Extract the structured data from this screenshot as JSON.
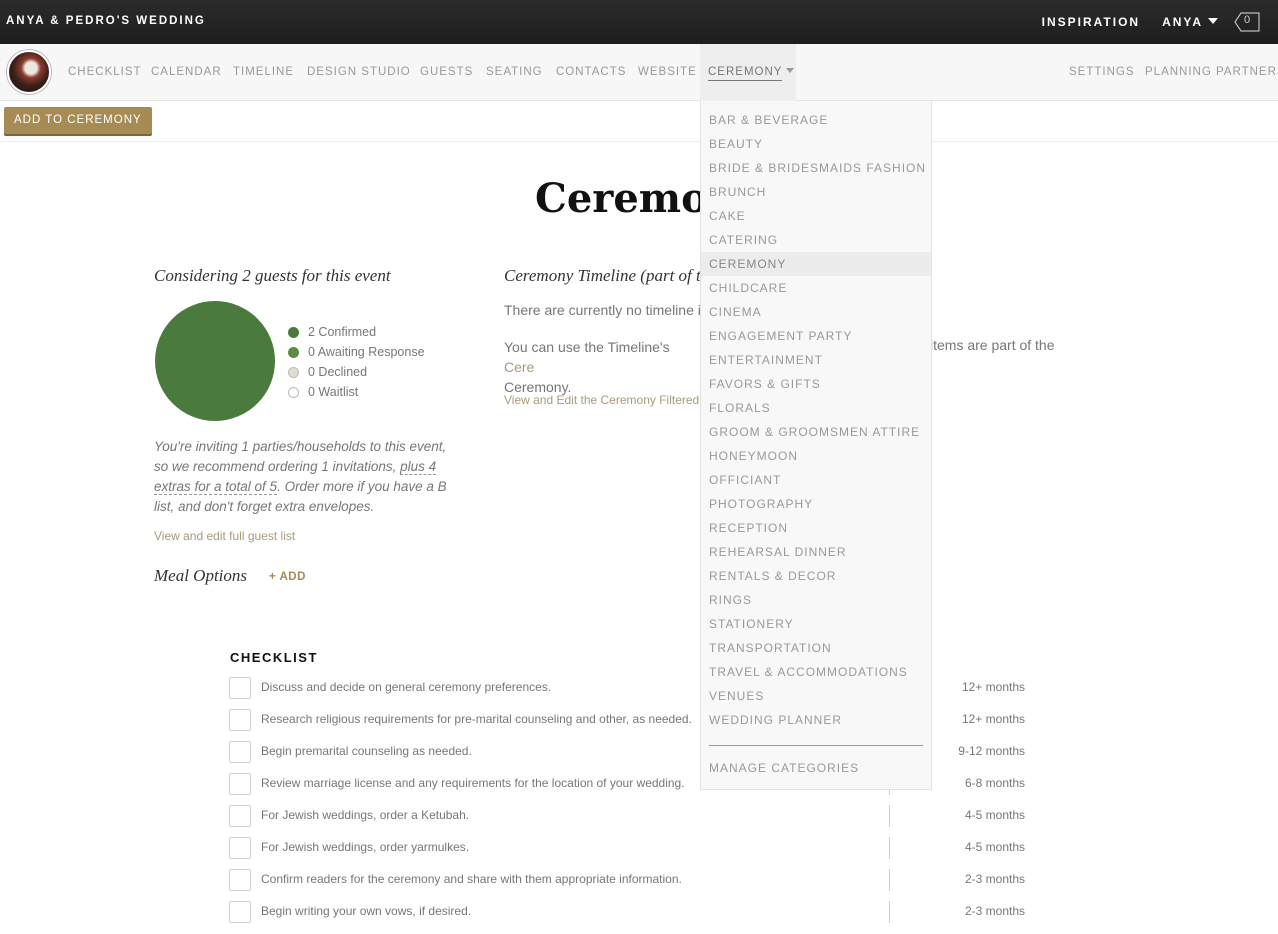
{
  "topbar": {
    "brand": "ANYA & PEDRO'S WEDDING",
    "inspiration": "INSPIRATION",
    "user": "ANYA",
    "cart_count": "0"
  },
  "nav": {
    "items": [
      "CHECKLIST",
      "CALENDAR",
      "TIMELINE",
      "DESIGN STUDIO",
      "GUESTS",
      "SEATING",
      "CONTACTS",
      "WEBSITE"
    ],
    "active": "CEREMONY",
    "right": [
      "SETTINGS",
      "PLANNING PARTNERS"
    ]
  },
  "actions": {
    "add_button": "ADD TO CEREMONY"
  },
  "page": {
    "title": "Ceremony"
  },
  "guests": {
    "heading": "Considering 2 guests for this event",
    "legend": [
      {
        "label": "2 Confirmed",
        "color": "#4a7a3d"
      },
      {
        "label": "0 Awaiting Response",
        "color": "#5c8a48"
      },
      {
        "label": "0 Declined",
        "color": "#e0ddd0"
      },
      {
        "label": "0 Waitlist",
        "color": "#ffffff"
      }
    ],
    "invite_text_1": "You're inviting 1 parties/households to this event, so we recommend ordering 1 invitations, ",
    "invite_text_u": "plus 4 extras for a total of 5",
    "invite_text_2": ". Order more if you have a B list, and don't forget extra envelopes.",
    "link": "View and edit full guest list"
  },
  "meal": {
    "heading": "Meal Options",
    "add": "+ ADD"
  },
  "timeline": {
    "heading": "Ceremony Timeline (part of the",
    "text1": "There are currently no timeline items",
    "text2_a": "You can use the Timeline's ",
    "text2_link": "Cere",
    "text2_b": "items are part of the",
    "text2_c": "Ceremony.",
    "link": "View and Edit the Ceremony Filtered Timeline"
  },
  "checklist": {
    "heading": "CHECKLIST",
    "items": [
      {
        "text": "Discuss and decide on general ceremony preferences.",
        "time": "12+ months"
      },
      {
        "text": "Research religious requirements for pre-marital counseling and other, as needed.",
        "time": "12+ months"
      },
      {
        "text": "Begin premarital counseling as needed.",
        "time": "9-12 months"
      },
      {
        "text": "Review marriage license and any requirements for the location of your wedding.",
        "time": "6-8 months"
      },
      {
        "text": "For Jewish weddings, order a Ketubah.",
        "time": "4-5 months"
      },
      {
        "text": "For Jewish weddings, order yarmulkes.",
        "time": "4-5 months"
      },
      {
        "text": "Confirm readers for the ceremony and share with them appropriate information.",
        "time": "2-3 months"
      },
      {
        "text": "Begin writing your own vows, if desired.",
        "time": "2-3 months"
      }
    ]
  },
  "dropdown": {
    "items": [
      "BAR & BEVERAGE",
      "BEAUTY",
      "BRIDE & BRIDESMAIDS FASHION",
      "BRUNCH",
      "CAKE",
      "CATERING",
      "CEREMONY",
      "CHILDCARE",
      "CINEMA",
      "ENGAGEMENT PARTY",
      "ENTERTAINMENT",
      "FAVORS & GIFTS",
      "FLORALS",
      "GROOM & GROOMSMEN ATTIRE",
      "HONEYMOON",
      "OFFICIANT",
      "PHOTOGRAPHY",
      "RECEPTION",
      "REHEARSAL DINNER",
      "RENTALS & DECOR",
      "RINGS",
      "STATIONERY",
      "TRANSPORTATION",
      "TRAVEL & ACCOMMODATIONS",
      "VENUES",
      "WEDDING PLANNER"
    ],
    "selected": "CEREMONY",
    "manage": "MANAGE CATEGORIES"
  }
}
